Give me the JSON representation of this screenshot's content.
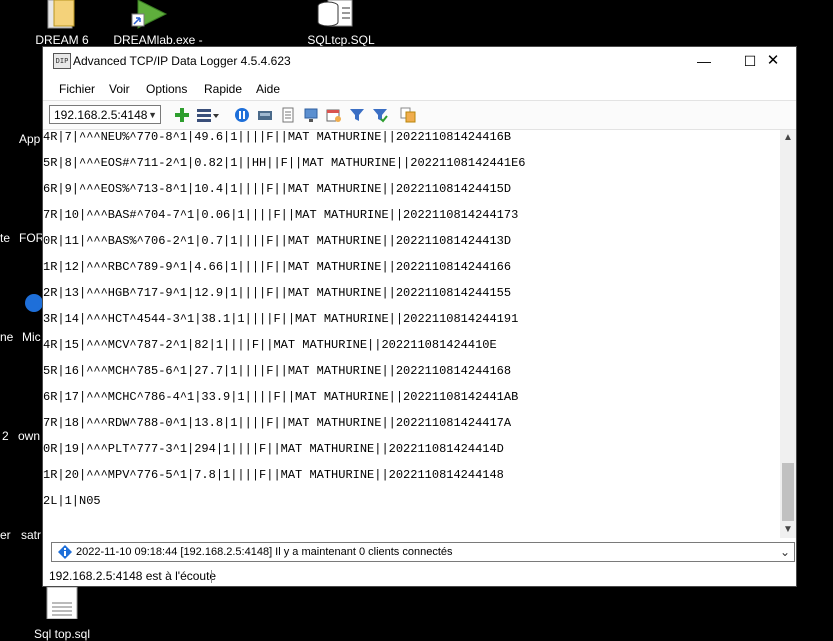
{
  "desktop": {
    "icons": [
      {
        "label": "DREAM 6"
      },
      {
        "label": "DREAMlab.exe -"
      },
      {
        "label": "SQLtcp.SQL"
      },
      {
        "label": "Sql top.sql"
      }
    ],
    "side_texts": [
      "App",
      "te",
      "FOR",
      "ne",
      "Mic",
      "2",
      "own",
      "er",
      "satr"
    ]
  },
  "window": {
    "title": "Advanced TCP/IP Data Logger 4.5.4.623",
    "app_icon_text": "DIP",
    "min_symbol": "—",
    "max_symbol": "☐",
    "close_symbol": "✕"
  },
  "menu": [
    "Fichier",
    "Voir",
    "Options",
    "Rapide",
    "Aide"
  ],
  "toolbar": {
    "connection_value": "192.168.2.5:4148",
    "icons": [
      "add-icon",
      "list-menu-icon",
      "pause-icon",
      "network-card-icon",
      "document-icon",
      "monitor-icon",
      "calendar-icon",
      "filter-icon",
      "filter-check-icon",
      "copy-icon"
    ]
  },
  "log_lines": [
    "4R|7|^^^NEU%^770-8^1|49.6|1||||F||MAT MATHURINE||202211081424416B",
    "5R|8|^^^EOS#^711-2^1|0.82|1||HH||F||MAT MATHURINE||20221108142441E6",
    "6R|9|^^^EOS%^713-8^1|10.4|1||||F||MAT MATHURINE||202211081424415D",
    "7R|10|^^^BAS#^704-7^1|0.06|1||||F||MAT MATHURINE||2022110814244173",
    "0R|11|^^^BAS%^706-2^1|0.7|1||||F||MAT MATHURINE||202211081424413D",
    "1R|12|^^^RBC^789-9^1|4.66|1||||F||MAT MATHURINE||2022110814244166",
    "2R|13|^^^HGB^717-9^1|12.9|1||||F||MAT MATHURINE||2022110814244155",
    "3R|14|^^^HCT^4544-3^1|38.1|1||||F||MAT MATHURINE||2022110814244191",
    "4R|15|^^^MCV^787-2^1|82|1||||F||MAT MATHURINE||202211081424410E",
    "5R|16|^^^MCH^785-6^1|27.7|1||||F||MAT MATHURINE||2022110814244168",
    "6R|17|^^^MCHC^786-4^1|33.9|1||||F||MAT MATHURINE||20221108142441AB",
    "7R|18|^^^RDW^788-0^1|13.8|1||||F||MAT MATHURINE||202211081424417A",
    "0R|19|^^^PLT^777-3^1|294|1||||F||MAT MATHURINE||202211081424414D",
    "1R|20|^^^MPV^776-5^1|7.8|1||||F||MAT MATHURINE||2022110814244148",
    "2L|1|N05"
  ],
  "status_combo": "2022-11-10 09:18:44 [192.168.2.5:4148] Il y a maintenant 0 clients connectés",
  "status_bar": "192.168.2.5:4148 est à l'écoute",
  "colors": {
    "accent": "#1e6fd9",
    "add_green": "#2e9e2e"
  }
}
